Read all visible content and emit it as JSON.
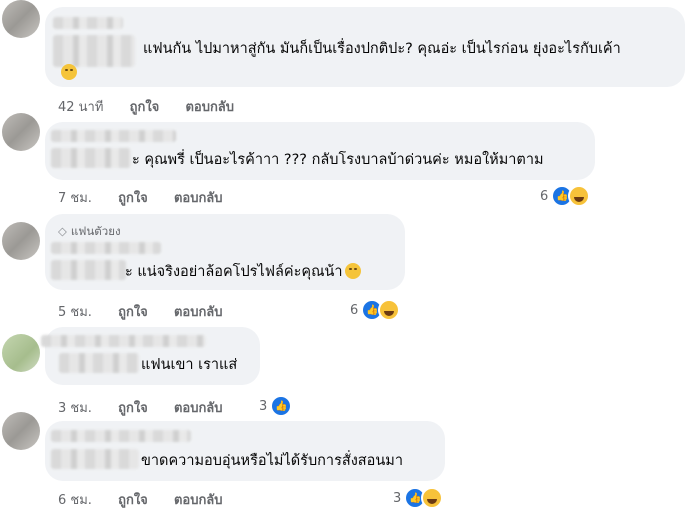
{
  "comments": [
    {
      "text": "แฟนกัน ไปมาหาสู่กัน มันก็เป็นเรื่องปกติปะ? คุณอ่ะ เป็นไรก่อน ยุ่งอะไรกับเค้า",
      "time": "42 นาที",
      "like": "ถูกใจ",
      "reply": "ตอบกลับ",
      "reaction_count": ""
    },
    {
      "text": "ะ คุณพรี่ เป็นอะไรค้าาา ??? กลับโรงบาลบ้าด่วนค่ะ หมอให้มาตาม",
      "time": "7 ชม.",
      "like": "ถูกใจ",
      "reply": "ตอบกลับ",
      "reaction_count": "6"
    },
    {
      "badge": "แฟนตัวยง",
      "text": "ะ แน่จริงอย่าล้อคโปรไฟล์ค่ะคุณน้า",
      "time": "5 ชม.",
      "like": "ถูกใจ",
      "reply": "ตอบกลับ",
      "reaction_count": "6"
    },
    {
      "text": "แฟนเขา เราแส่",
      "time": "3 ชม.",
      "like": "ถูกใจ",
      "reply": "ตอบกลับ",
      "reaction_count": "3"
    },
    {
      "text": "ขาดความอบอุ่นหรือไม่ได้รับการสั่งสอนมา",
      "time": "6 ชม.",
      "like": "ถูกใจ",
      "reply": "ตอบกลับ",
      "reaction_count": "3"
    }
  ],
  "icons": {
    "like": "thumbs-up-icon",
    "haha": "haha-emoji-icon",
    "badge": "diamond-icon"
  },
  "colors": {
    "bubble": "#f0f2f5",
    "secondary_text": "#65676b",
    "like_blue": "#1b74e4"
  }
}
